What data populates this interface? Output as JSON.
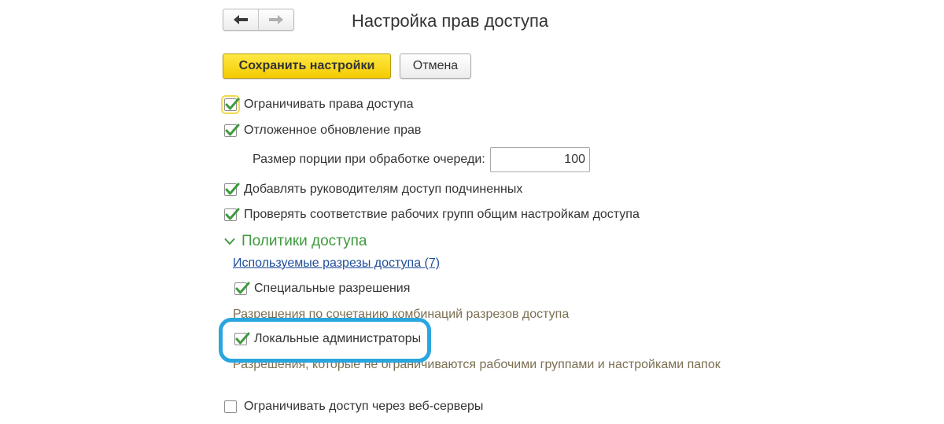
{
  "header": {
    "back_glyph": "🡐",
    "forward_glyph": "🡒",
    "title": "Настройка прав доступа"
  },
  "toolbar": {
    "save_label": "Сохранить настройки",
    "cancel_label": "Отмена"
  },
  "options": {
    "restrict_access": {
      "label": "Ограничивать права доступа",
      "checked": true
    },
    "deferred_update": {
      "label": "Отложенное обновление прав",
      "checked": true
    },
    "batch_size": {
      "label": "Размер порции при обработке очереди:",
      "value": "100"
    },
    "managers_access": {
      "label": "Добавлять руководителям доступ подчиненных",
      "checked": true
    },
    "check_workgroups": {
      "label": "Проверять соответствие рабочих групп общим настройкам доступа",
      "checked": true
    }
  },
  "policies": {
    "section_title": "Политики доступа",
    "link_label": "Используемые разрезы доступа (7)",
    "special_permissions": {
      "label": "Специальные разрешения",
      "checked": true
    },
    "special_hint": "Разрешения по сочетанию комбинаций разрезов доступа",
    "local_admins": {
      "label": "Локальные администраторы",
      "checked": true
    },
    "local_admins_hint": "Разрешения, которые не ограничиваются рабочими группами и настройками папок"
  },
  "web_servers": {
    "label": "Ограничивать доступ через веб-серверы",
    "checked": false
  },
  "colors": {
    "accent_yellow": "#f4cb00",
    "check_green": "#3f9a3f",
    "link_blue": "#1f4e9b",
    "hint_text": "#7b6f52",
    "highlight": "#2aa6df"
  }
}
